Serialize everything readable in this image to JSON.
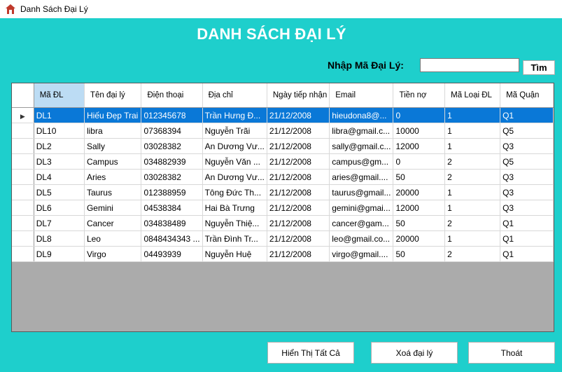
{
  "window": {
    "title": "Danh Sách Đại Lý",
    "icon": "house-icon"
  },
  "heading": "DANH SÁCH ĐẠI LÝ",
  "search": {
    "label": "Nhập Mã Đại Lý:",
    "value": "",
    "button": "Tìm"
  },
  "table": {
    "columns": [
      "Mã ĐL",
      "Tên đại lý",
      "Điện thoại",
      "Địa chỉ",
      "Ngày tiếp nhận",
      "Email",
      "Tiền nợ",
      "Mã Loại ĐL",
      "Mã Quận"
    ],
    "rows": [
      [
        "DL1",
        "Hiếu Đẹp Trai",
        "012345678",
        "Trần Hưng Đ...",
        "21/12/2008",
        "hieudona8@...",
        "0",
        "1",
        "Q1"
      ],
      [
        "DL10",
        "libra",
        "07368394",
        "Nguyễn Trãi",
        "21/12/2008",
        "libra@gmail.c...",
        "10000",
        "1",
        "Q5"
      ],
      [
        "DL2",
        "Sally",
        "03028382",
        "An Dương Vư...",
        "21/12/2008",
        "sally@gmail.c...",
        "12000",
        "1",
        "Q3"
      ],
      [
        "DL3",
        "Campus",
        "034882939",
        "Nguyễn Văn ...",
        "21/12/2008",
        "campus@gm...",
        "0",
        "2",
        "Q5"
      ],
      [
        "DL4",
        "Aries",
        "03028382",
        "An Dương Vư...",
        "21/12/2008",
        "aries@gmail....",
        "50",
        "2",
        "Q3"
      ],
      [
        "DL5",
        "Taurus",
        "012388959",
        "Tông Đức Th...",
        "21/12/2008",
        "taurus@gmail...",
        "20000",
        "1",
        "Q3"
      ],
      [
        "DL6",
        "Gemini",
        "04538384",
        "Hai Bà Trưng",
        "21/12/2008",
        "gemini@gmai...",
        "12000",
        "1",
        "Q3"
      ],
      [
        "DL7",
        "Cancer",
        "034838489",
        "Nguyễn Thiệ...",
        "21/12/2008",
        "cancer@gam...",
        "50",
        "2",
        "Q1"
      ],
      [
        "DL8",
        "Leo",
        "0848434343 ...",
        "Trần Đình Tr...",
        "21/12/2008",
        "leo@gmail.co...",
        "20000",
        "1",
        "Q1"
      ],
      [
        "DL9",
        "Virgo",
        "04493939",
        "Nguyễn Huệ",
        "21/12/2008",
        "virgo@gmail....",
        "50",
        "2",
        "Q1"
      ]
    ]
  },
  "buttons": {
    "show_all": "Hiển Thị Tất Cả",
    "delete": "Xoá đại lý",
    "exit": "Thoát"
  },
  "colors": {
    "background": "#1ecfcc",
    "selection": "#0a78d7",
    "sorted_header": "#bcdcf4"
  }
}
